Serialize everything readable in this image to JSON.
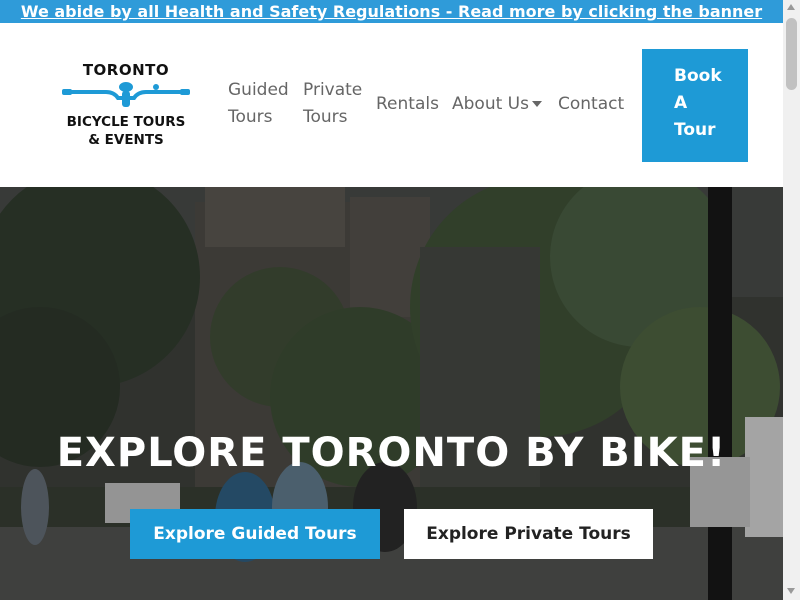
{
  "banner": {
    "text": "We abide by all Health and Safety Regulations - Read more by clicking the banner"
  },
  "logo": {
    "line1": "TORONTO",
    "line2": "BICYCLE TOURS",
    "line3": "& EVENTS",
    "icon": "bicycle-handlebar-icon"
  },
  "nav": {
    "guided_line1": "Guided",
    "guided_line2": "Tours",
    "private_line1": "Private",
    "private_line2": "Tours",
    "rentals": "Rentals",
    "about": "About Us",
    "contact": "Contact"
  },
  "book": {
    "line1": "Book",
    "line2": "A",
    "line3": "Tour"
  },
  "hero": {
    "title": "EXPLORE TORONTO BY BIKE!",
    "guided_button": "Explore Guided Tours",
    "private_button": "Explore Private Tours"
  },
  "colors": {
    "accent": "#1e9ad6",
    "banner": "#2f9bd9",
    "nav_text": "#666666"
  }
}
